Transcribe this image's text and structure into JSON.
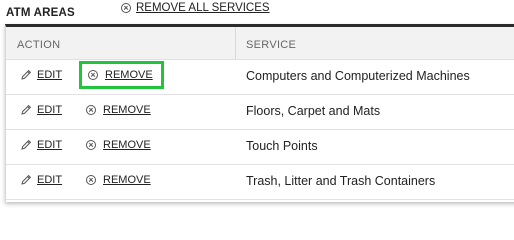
{
  "header": {
    "title": "ATM AREAS",
    "remove_all_label": "REMOVE ALL SERVICES"
  },
  "table": {
    "columns": {
      "action": "ACTION",
      "service": "SERVICE"
    },
    "edit_label": "EDIT",
    "remove_label": "REMOVE",
    "rows": [
      {
        "service": "Computers and Computerized Machines",
        "highlighted": true
      },
      {
        "service": "Floors, Carpet and Mats",
        "highlighted": false
      },
      {
        "service": "Touch Points",
        "highlighted": false
      },
      {
        "service": "Trash, Litter and Trash Containers",
        "highlighted": false
      }
    ]
  },
  "colors": {
    "highlight": "#22c33d",
    "header_bg": "#f2f2f2",
    "top_border": "#2b2b2b"
  }
}
